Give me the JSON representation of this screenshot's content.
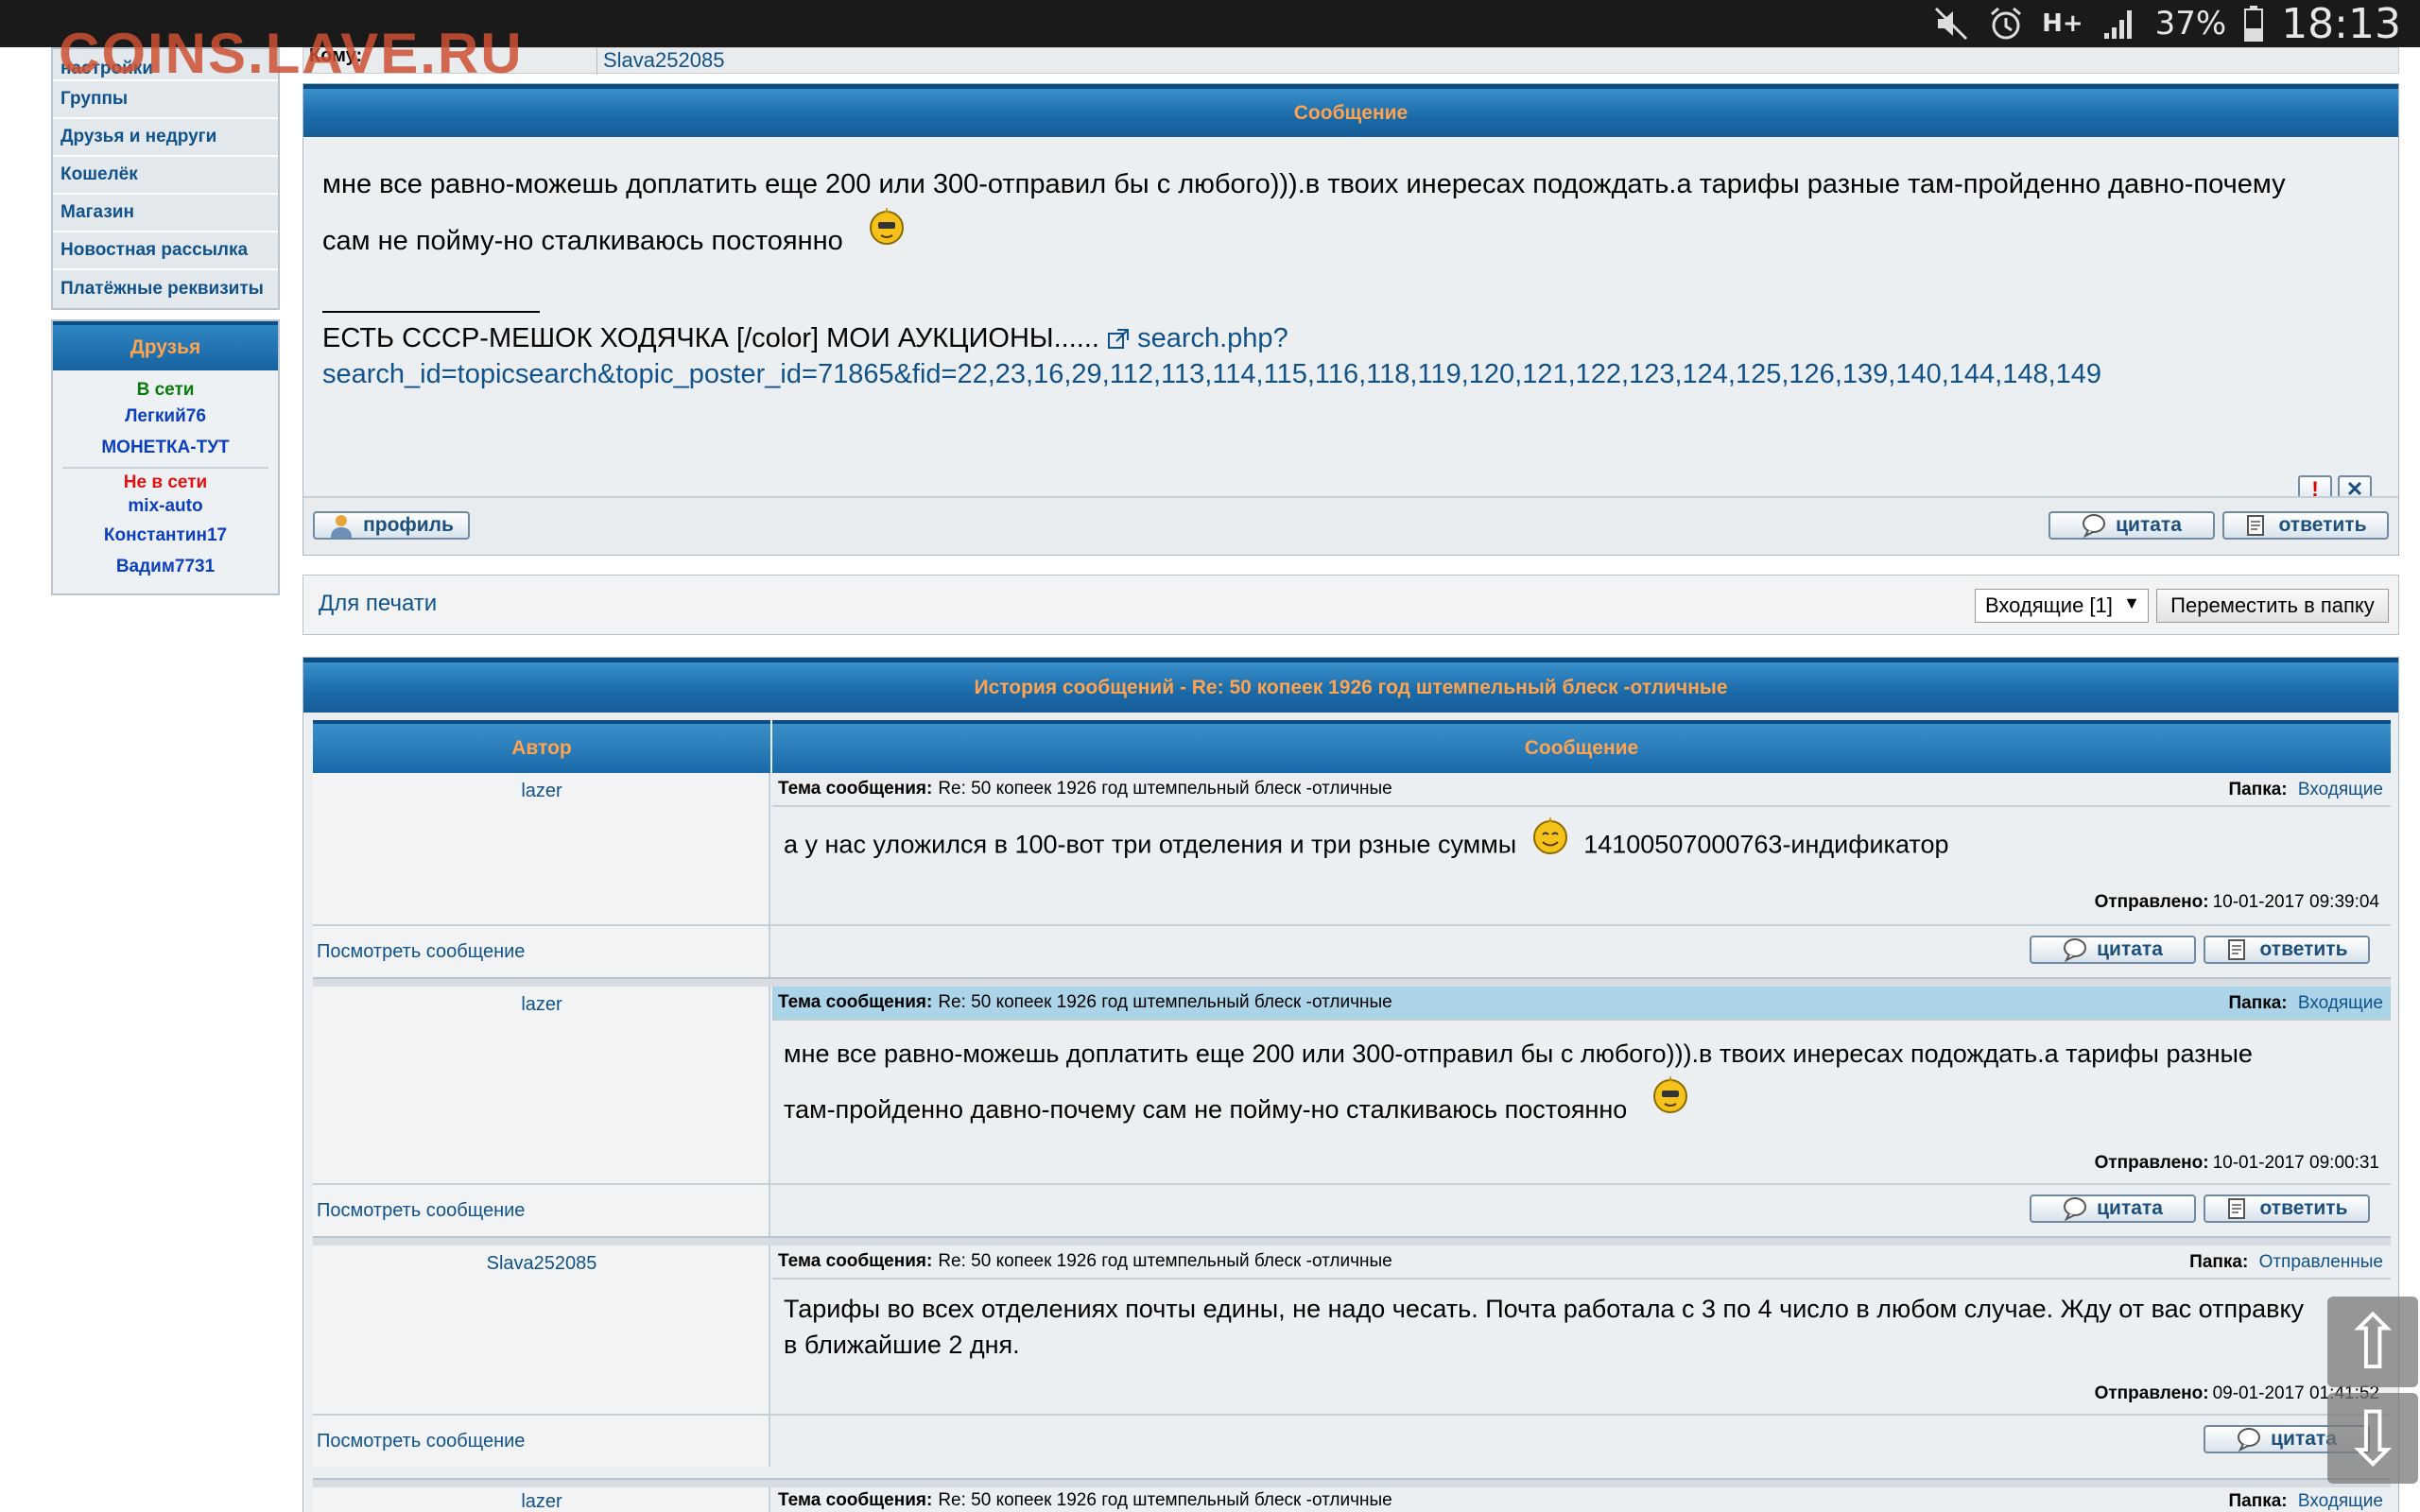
{
  "status_bar": {
    "battery": "37%",
    "time": "18:13",
    "network": "H+",
    "icons": [
      "mute-icon",
      "alarm-icon",
      "network-hplus-icon",
      "signal-icon",
      "battery-icon"
    ]
  },
  "watermark": "COINS.LAVE.RU",
  "sidebar": {
    "partial_item": "настройки",
    "items": [
      "Группы",
      "Друзья и недруги",
      "Кошелёк",
      "Магазин",
      "Новостная рассылка",
      "Платёжные реквизиты"
    ],
    "friends": {
      "title": "Друзья",
      "online_label": "В сети",
      "online": [
        "Легкий76",
        "МОНЕТКА-ТУТ"
      ],
      "offline_label": "Не в сети",
      "offline": [
        "mix-auto",
        "Константин17",
        "Вадим7731"
      ]
    }
  },
  "to_row": {
    "label": "Кому:",
    "value": "Slava252085"
  },
  "message": {
    "header": "Сообщение",
    "line1": "мне все равно-можешь доплатить еще 200 или 300-отправил бы с любого))).в твоих инересах подождать.а тарифы разные там-пройденно давно-почему",
    "line2": "сам не пойму-но сталкиваюсь постоянно",
    "sig_text": "ЕСТЬ СССР-МЕШОК ХОДЯЧКА [/color] МОИ АУКЦИОНЫ......",
    "sig_link_1": "search.php?",
    "sig_link_2": "search_id=topicsearch&topic_poster_id=71865&fid=22,23,16,29,112,113,114,115,116,118,119,120,121,122,123,124,125,126,139,140,144,148,149",
    "report_icon": "!",
    "delete_icon": "✕"
  },
  "buttons": {
    "profile": "профиль",
    "quote": "цитата",
    "reply": "ответить"
  },
  "print_row": {
    "print": "Для печати",
    "folder_select": "Входящие [1]",
    "move": "Переместить в папку"
  },
  "history": {
    "title": "История сообщений - Re: 50 копеек 1926 год штемпельный блеск -отличные",
    "col_author": "Автор",
    "col_message": "Сообщение",
    "subject_label": "Тема сообщения:",
    "folder_label": "Папка:",
    "sent_label": "Отправлено:",
    "view_label": "Посмотреть сообщение",
    "entries": [
      {
        "author": "lazer",
        "subject": "Re: 50 копеек 1926 год штемпельный блеск -отличные",
        "folder": "Входящие",
        "text_before": "а у нас уложился в 100-вот три отделения и три рзные суммы",
        "text_after": "14100507000763-индификатор",
        "sent": "10-01-2017 09:39:04"
      },
      {
        "author": "lazer",
        "subject": "Re: 50 копеек 1926 год штемпельный блеск -отличные",
        "folder": "Входящие",
        "line1": "мне все равно-можешь доплатить еще 200 или 300-отправил бы с любого))).в твоих инересах подождать.а тарифы разные",
        "line2": "там-пройденно давно-почему сам не пойму-но сталкиваюсь постоянно",
        "sent": "10-01-2017 09:00:31"
      },
      {
        "author": "Slava252085",
        "subject": "Re: 50 копеек 1926 год штемпельный блеск -отличные",
        "folder": "Отправленные",
        "line1": "Тарифы во всех отделениях почты едины, не надо чесать. Почта работала с 3 по 4 число в любом случае. Жду от вас отправку",
        "line2": "в ближайшие 2 дня.",
        "sent": "09-01-2017 01:41:52"
      },
      {
        "author": "lazer",
        "subject": "Re: 50 копеек 1926 год штемпельный блеск -отличные",
        "folder": "Входящие"
      }
    ]
  },
  "colors": {
    "header_gradient": "#1a6aa8",
    "header_text": "#ffa34f",
    "link": "#105289",
    "online": "#0a7a0a",
    "offline": "#e01010"
  }
}
